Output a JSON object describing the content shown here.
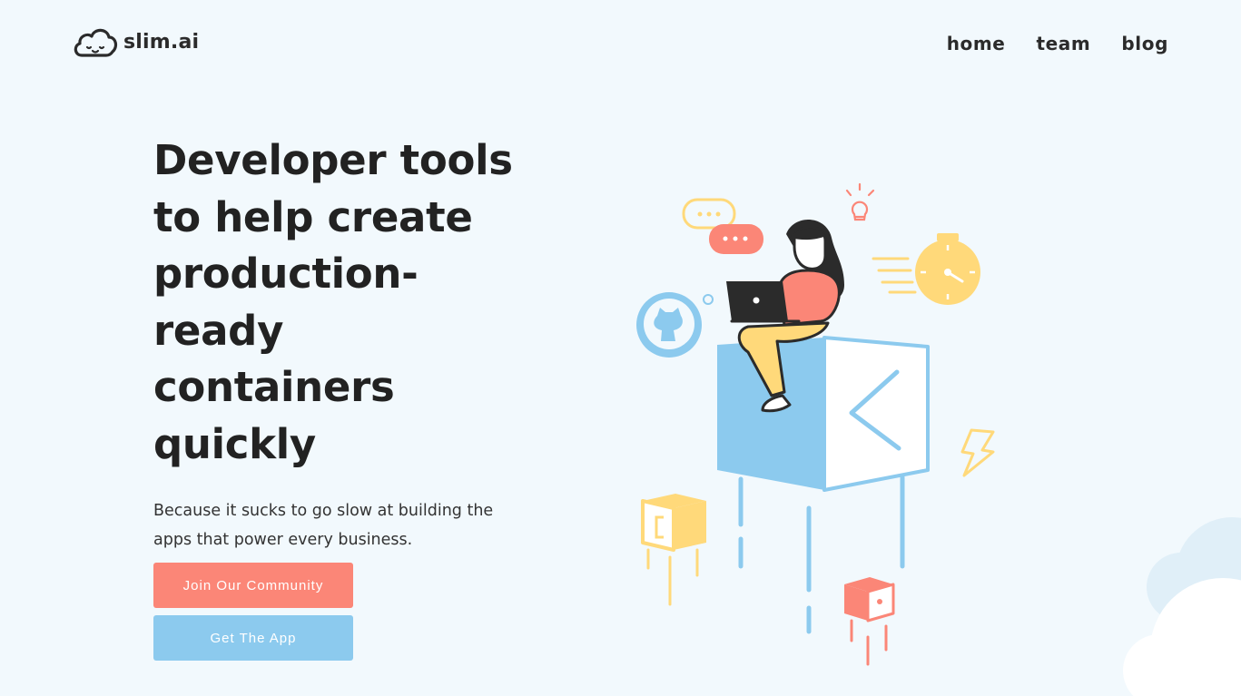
{
  "header": {
    "logo_text": "slim.ai",
    "nav": [
      {
        "label": "home"
      },
      {
        "label": "team"
      },
      {
        "label": "blog"
      }
    ]
  },
  "hero": {
    "title": "Developer tools to help create production-ready containers quickly",
    "subtitle": "Because it sucks to go slow at building the apps that power every business.",
    "primary_button": "Join Our Community",
    "secondary_button": "Get The App"
  },
  "colors": {
    "background": "#f2f9fd",
    "coral": "#fb8677",
    "sky_blue": "#8ccaee",
    "yellow": "#ffd97a",
    "text": "#222222"
  },
  "icons": [
    "cloud-logo-icon",
    "github-icon",
    "chat-bubble-icon",
    "lightbulb-icon",
    "stopwatch-icon",
    "lightning-icon"
  ]
}
